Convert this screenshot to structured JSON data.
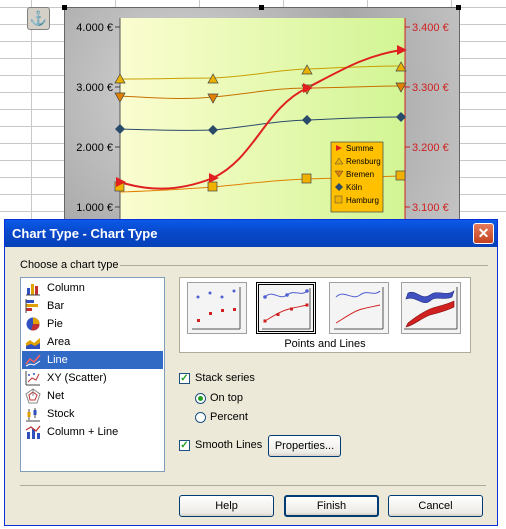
{
  "chart": {
    "left_axis": [
      "4.000 €",
      "3.000 €",
      "2.000 €",
      "1.000 €"
    ],
    "right_axis": [
      "3.400 €",
      "3.300 €",
      "3.200 €",
      "3.100 €"
    ],
    "legend": [
      "Summe",
      "Rensburg",
      "Bremen",
      "Köln",
      "Hamburg"
    ],
    "colors": {
      "summe": "#e02020",
      "rensburg": "#c8a000",
      "bremen": "#c87000",
      "koeln": "#2a4a6a",
      "hamburg": "#e08000"
    }
  },
  "dialog": {
    "title": "Chart Type - Chart Type",
    "group_label": "Choose a chart type",
    "chart_types": [
      {
        "label": "Column",
        "icon": "column-chart-icon"
      },
      {
        "label": "Bar",
        "icon": "bar-chart-icon"
      },
      {
        "label": "Pie",
        "icon": "pie-chart-icon"
      },
      {
        "label": "Area",
        "icon": "area-chart-icon"
      },
      {
        "label": "Line",
        "icon": "line-chart-icon",
        "selected": true
      },
      {
        "label": "XY (Scatter)",
        "icon": "scatter-chart-icon"
      },
      {
        "label": "Net",
        "icon": "net-chart-icon"
      },
      {
        "label": "Stock",
        "icon": "stock-chart-icon"
      },
      {
        "label": "Column + Line",
        "icon": "column-line-chart-icon"
      }
    ],
    "variant_caption": "Points and Lines",
    "stack_series": "Stack series",
    "on_top": "On top",
    "percent": "Percent",
    "smooth_lines": "Smooth Lines",
    "properties": "Properties...",
    "help": "Help",
    "finish": "Finish",
    "cancel": "Cancel"
  }
}
